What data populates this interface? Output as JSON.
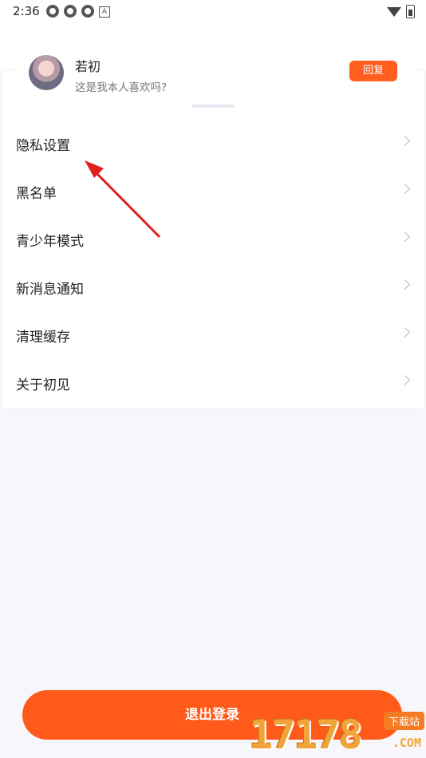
{
  "status_bar": {
    "time": "2:36",
    "indicator_letter": "A"
  },
  "notification": {
    "name": "若初",
    "message": "这是我本人喜欢吗?",
    "reply_label": "回复"
  },
  "menu": {
    "items": [
      {
        "label": "隐私设置"
      },
      {
        "label": "黑名单"
      },
      {
        "label": "青少年模式"
      },
      {
        "label": "新消息通知"
      },
      {
        "label": "清理缓存"
      },
      {
        "label": "关于初见"
      }
    ]
  },
  "logout_label": "退出登录",
  "watermark": {
    "digits": "17178",
    "tag": "下载站",
    "suffix": ".COM"
  },
  "colors": {
    "accent": "#ff5a1a",
    "annotation_arrow": "#e02020"
  }
}
